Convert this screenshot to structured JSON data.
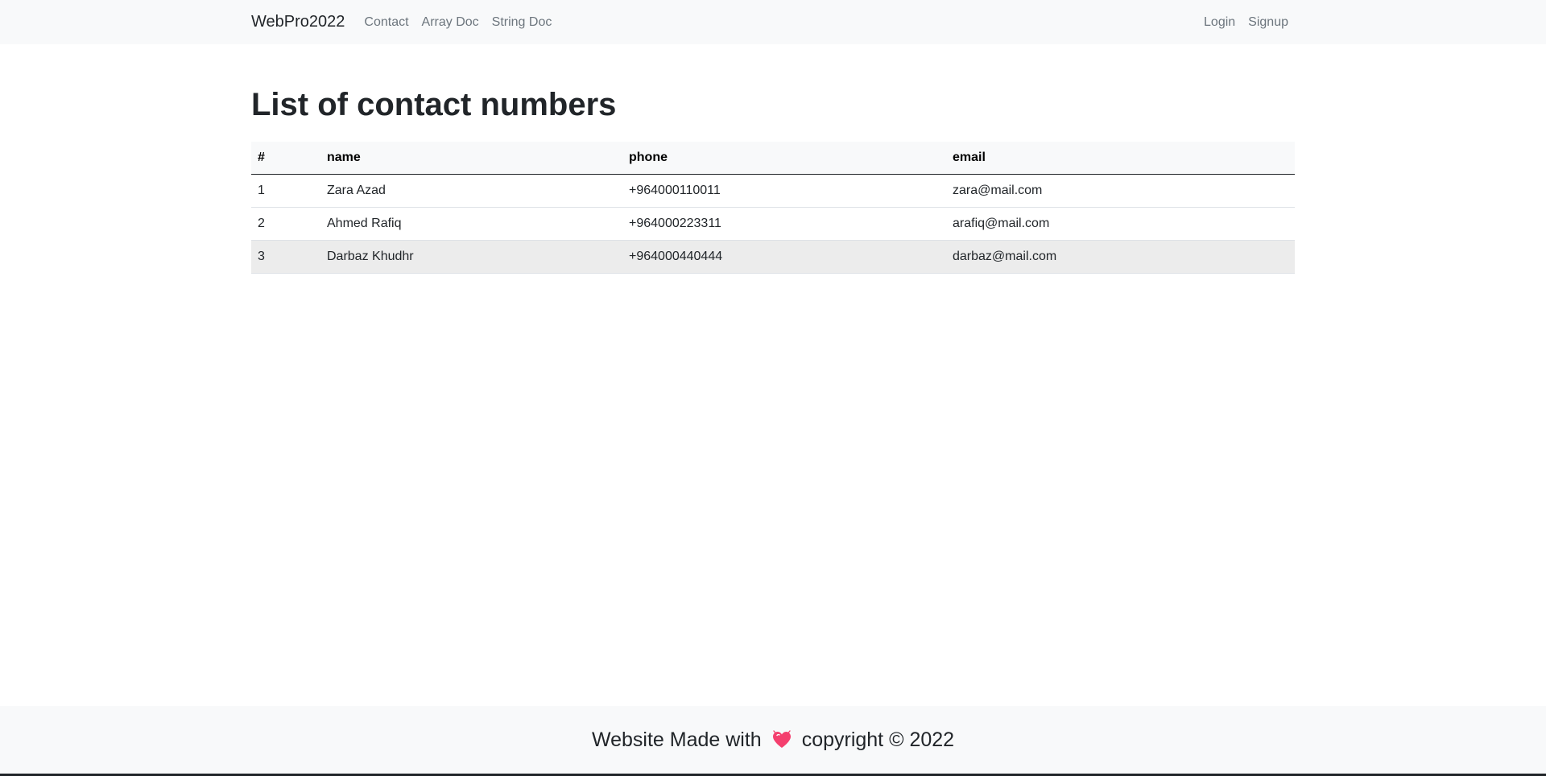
{
  "navbar": {
    "brand": "WebPro2022",
    "links": [
      "Contact",
      "Array Doc",
      "String Doc"
    ],
    "right_links": [
      "Login",
      "Signup"
    ]
  },
  "main": {
    "title": "List of contact numbers",
    "table": {
      "headers": [
        "#",
        "name",
        "phone",
        "email"
      ],
      "rows": [
        [
          "1",
          "Zara Azad",
          "+964000110011",
          "zara@mail.com"
        ],
        [
          "2",
          "Ahmed Rafiq",
          "+964000223311",
          "arafiq@mail.com"
        ],
        [
          "3",
          "Darbaz Khudhr",
          "+964000440444",
          "darbaz@mail.com"
        ]
      ]
    }
  },
  "footer": {
    "text_before": "Website Made with",
    "icon": "heart-icon",
    "text_after": "copyright © 2022"
  },
  "colors": {
    "navbar_bg": "#f8f9fa",
    "heart": "#f43f6e"
  }
}
